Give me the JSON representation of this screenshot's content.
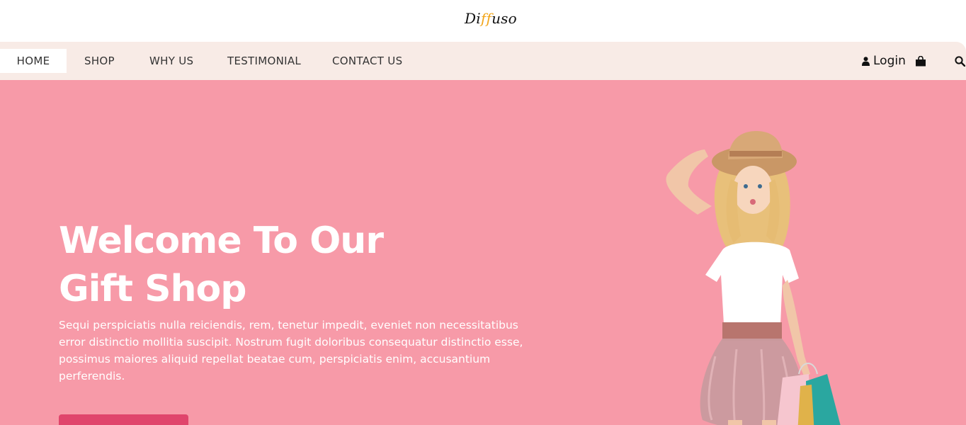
{
  "brand": {
    "logo_prefix": "Di",
    "logo_accent": "ff",
    "logo_suffix": "uso"
  },
  "nav": {
    "items": [
      {
        "label": "HOME",
        "active": true
      },
      {
        "label": "SHOP",
        "active": false
      },
      {
        "label": "WHY US",
        "active": false
      },
      {
        "label": "TESTIMONIAL",
        "active": false
      },
      {
        "label": "CONTACT US",
        "active": false
      }
    ],
    "login_label": "Login",
    "icons": {
      "login": "user-icon",
      "cart": "shopping-bag-icon",
      "search": "search-icon"
    }
  },
  "hero": {
    "title_line1": "Welcome To Our",
    "title_line2": "Gift Shop",
    "description": "Sequi perspiciatis nulla reiciendis, rem, tenetur impedit, eveniet non necessitatibus error distinctio mollitia suscipit. Nostrum fugit doloribus consequatur distinctio esse, possimus maiores aliquid repellat beatae cum, perspiciatis enim, accusantium perferendis."
  },
  "colors": {
    "nav_bg": "#f8ebe6",
    "hero_bg": "#f79aa8",
    "accent": "#e0456c",
    "logo_accent": "#f2a51a"
  }
}
